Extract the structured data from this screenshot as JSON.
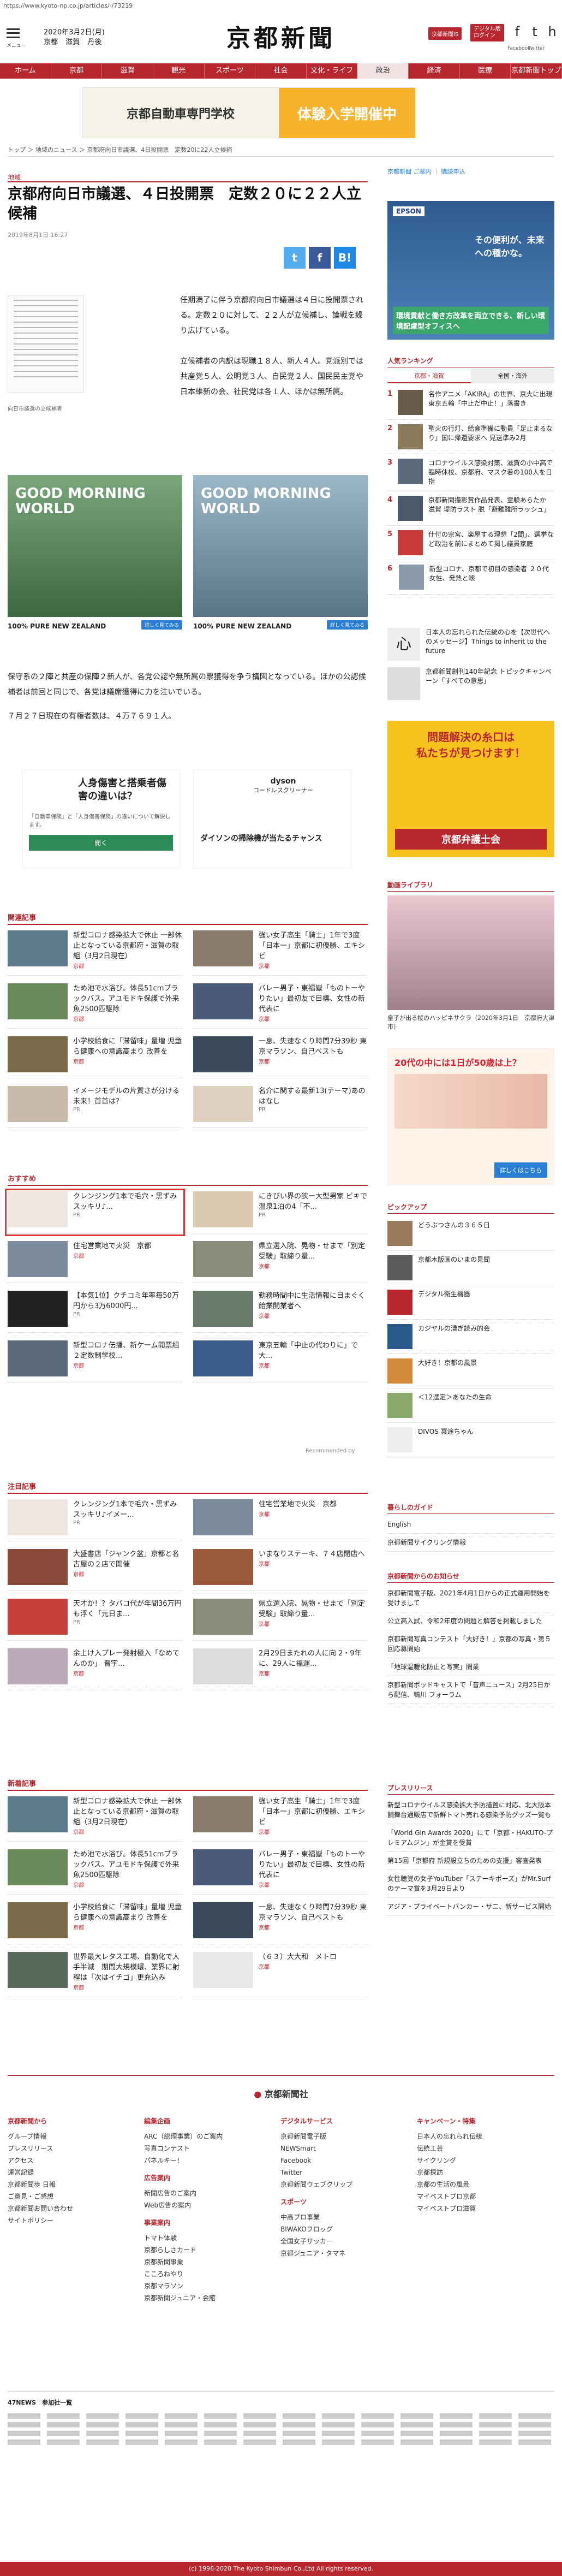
{
  "url": "https://www.kyoto-np.co.jp/articles/-/73219",
  "header": {
    "menu_label": "メニュー",
    "date": "2020年3月2日(月)",
    "weather": [
      "京都",
      "滋賀",
      "丹後"
    ],
    "logo": "京都新聞",
    "btn_member": "京都新聞IS",
    "btn_digital": "デジタル版\nログイン",
    "social": [
      {
        "icon": "f",
        "label": "Facebook"
      },
      {
        "icon": "t",
        "label": "Twitter"
      },
      {
        "icon": "h",
        "label": "ホーム"
      }
    ]
  },
  "nav": [
    "ホーム",
    "京都",
    "滋賀",
    "観光",
    "スポーツ",
    "社会",
    "文化・ライフ",
    "政治",
    "経済",
    "医療",
    "京都新聞トップ"
  ],
  "banner": {
    "left": "京都自動車専門学校",
    "right": "体験入学開催中"
  },
  "breadcrumb": "トップ ＞ 地域のニュース ＞ 京都府向日市議選、4日投開票　定数20に22人立候補",
  "article": {
    "region": "地域",
    "title": "京都府向日市議選、４日投開票　定数２０に２２人立候補",
    "date": "2019年8月1日 16:27",
    "lead": "任期満了に伴う京都府向日市議選は４日に投開票される。定数２０に対して、２２人が立候補し、論戦を繰り広げている。\n\n立候補者の内訳は現職１８人、新人４人。党派別では共産党５人、公明党３人、自民党２人、国民民主党や日本維新の会、社民党は各１人、ほかは無所属。",
    "caption": "向日市議選の立候補者",
    "body2": "保守系の２陣と共産の保陣２新人が、各党公認や無所属の票獲得を争う構図となっている。ほかの公認候補者は前回と同じで、各党は議席獲得に力を注いでいる。",
    "body3": "７月２７日現在の有権者数は、４万７６９１人。",
    "ad1": {
      "title": "100% PURE NEW ZEALAND",
      "text": "GOOD MORNING WORLD",
      "btn": "詳しく見てみる"
    },
    "ad2": {
      "title": "100% PURE NEW ZEALAND",
      "text": "GOOD MORNING WORLD",
      "btn": "詳しく見てみる"
    },
    "ad3": {
      "title": "人身傷害と搭乗者傷害の違いは？",
      "sub": "「自動車保険」と「人身傷害保険」の違いについて解説します。",
      "btn": "開く"
    },
    "ad4": {
      "title": "ダイソンの掃除機が当たるチャンス",
      "brand": "dyson",
      "sub": "コードレスクリーナー"
    }
  },
  "related": {
    "header": "関連記事",
    "items": [
      {
        "t": "新型コロナ感染拡大で休止 一部休止となっている京都府・滋賀の取組（3月2日現在）",
        "tag": "京都"
      },
      {
        "t": "強い女子高生「騎士」1年で3度「日本一」京都に初優勝、エキシビ",
        "tag": "京都"
      },
      {
        "t": "ため池で水浴び。体長51cmブラックバス。アユモドキ保護で外来魚2500匹駆除",
        "tag": "京都"
      },
      {
        "t": "バレー男子・東福嶽「ものトーやりたい」最初友で目標、女性の新代表に",
        "tag": "京都"
      },
      {
        "t": "小学校給食に「滞留味」量増 児童ら健康への意識高まり 改善を",
        "tag": "京都"
      },
      {
        "t": "一息、失速なくり時間7分39秒 東京マラソン、自己ベストも",
        "tag": "京都"
      },
      {
        "t": "イメージモデルの片質さが分ける未来！首首は？",
        "tag": "PR"
      },
      {
        "t": "名介に関する最新13(テーマ)あのはなし",
        "tag": "PR"
      }
    ]
  },
  "recommend": {
    "header": "おすすめ",
    "items": [
      {
        "t": "クレンジング1本で毛穴・黒ずみスッキリ♪...",
        "tag": "PR"
      },
      {
        "t": "にきびい界の狭ー大型男家 ビキで温泉1泊の4「不...",
        "tag": "PR"
      },
      {
        "t": "住宅営業地で火災　京都",
        "tag": "京都"
      },
      {
        "t": "県立選入院、晃物・せまで「別定受験」取締り量...",
        "tag": "京都"
      },
      {
        "t": "【本気1位】クチコミ年率毎50万円から3万6000円...",
        "tag": "PR"
      },
      {
        "t": "勤務時間中に生活情報に目まぐく　給業開業者へ",
        "tag": "京都"
      },
      {
        "t": "新型コロナ伝播、新ケーム開票組 ２定数制学校...",
        "tag": "京都"
      },
      {
        "t": "東京五輪「中止の代わりに」で大...",
        "tag": "京都"
      }
    ],
    "footer": "Recommended by"
  },
  "featured": {
    "header": "注目記事",
    "items": [
      {
        "t": "クレンジング1本で毛穴・黒ずみスッキリ♪イメー...",
        "tag": "PR"
      },
      {
        "t": "住宅営業地で火災　京都",
        "tag": "京都"
      },
      {
        "t": "大盛書店「ジャンク盆」京都と名古屋の２店で開催",
        "tag": "京都"
      },
      {
        "t": "いまなりステーキ、７４店閉店へ",
        "tag": "京都"
      },
      {
        "t": "天才か！？タバコ代が年間36万円も浮く「元日ま...",
        "tag": "PR"
      },
      {
        "t": "県立選入院、晃物・せまで「別定受験」取締り量...",
        "tag": "京都"
      },
      {
        "t": "余上け入プレー発射極入「なめてんのか」 晋宇...",
        "tag": "京都"
      },
      {
        "t": "2月29日またれの人に向 2・9年に、29人に福運...",
        "tag": "京都"
      }
    ]
  },
  "latest": {
    "header": "新着記事",
    "items": [
      {
        "t": "新型コロナ感染拡大で休止 一部休止となっている京都府・滋賀の取組（3月2日現在）",
        "tag": "京都"
      },
      {
        "t": "強い女子高生「騎士」1年で3度「日本一」京都に初優勝、エキシビ",
        "tag": "京都"
      },
      {
        "t": "ため池で水浴び。体長51cmブラックバス。アユモドキ保護で外来魚2500匹駆除",
        "tag": "京都"
      },
      {
        "t": "バレー男子・東福嶽「ものトーやりたい」最初友で目標、女性の新代表に",
        "tag": "京都"
      },
      {
        "t": "小学校給食に「滞留味」量増 児童ら健康への意識高まり 改善を",
        "tag": "京都"
      },
      {
        "t": "一息、失速なくり時間7分39秒 東京マラソン、自己ベストも",
        "tag": "京都"
      },
      {
        "t": "世界最大レタス工場、自動化で人手半減　期間大規模環、業界に射程は「次はイチゴ」更充込み",
        "tag": "京都"
      },
      {
        "t": "（６３）大大和　メトロ",
        "tag": "京都"
      }
    ]
  },
  "sidebar": {
    "links": [
      "京都新聞 ご案内",
      "購読申込"
    ],
    "ad_epson": {
      "brand": "EPSON",
      "main": "その便利が、未来への種かな。",
      "sub": "環境貢献と働き方改革を両立できる、新しい環境配慮型オフィスへ"
    },
    "ranking": {
      "header": "人気ランキング",
      "tabs": [
        "京都・滋賀",
        "全国・海外"
      ],
      "items": [
        "名作アニメ「AKIRA」の世界、京大に出現 東京五輪「中止だ中止！」落書き",
        "聖火の行灯、給食準備に動員「足止まるなり」国に帰還要求へ 見送準み2月",
        "コロナウイルス感染対策、滋賀の小中高で臨時休校、京都府、マスク着の100人を日指",
        "京都新聞撮影賞作品発表、霊験あらたか 滋賀 堤防ラスト 脱「避難難所ラッシュ」",
        "仕付の宗宮、楽屋する理想「2間」、選挙など政治を前にまとめて掲し議員家庭",
        "新型コロナ、京都で初目の感染者 ２０代女性、発熱と咳"
      ]
    },
    "mosaic": "日本人の忘れられた伝統の心を【次世代へのメッセージ】Things to inherit to the future",
    "mosaic2": "京都新聞創刊140年記念 トピックキャンペーン「すべての意思」",
    "ad_bengoshi": {
      "top": "問題解決の糸口は",
      "main": "私たちが見つけます！",
      "footer": "京都弁護士会"
    },
    "photo": {
      "header": "動画ライブラリ",
      "cap": "皇子が出る桜のハッピネサクラ（2020年3月1日　京都府大津市）"
    },
    "ad_bottom": {
      "main": "20代の中には1日が50歳は上？",
      "btn": "詳しくはこちら"
    },
    "pickup": {
      "header": "ピックアップ",
      "items": [
        "どうぶつさんの３６５日",
        "京都木版画のいまの見聞",
        "デジタル衛生機器",
        "カジヤルの漕ぎ読み的会",
        "大好き！京都の風景",
        "＜12選定＞あなたの生命",
        "DIVOS 冥途ちゃん"
      ]
    },
    "kurashi": {
      "header": "暮らしのガイド",
      "items": [
        "English",
        "京都新聞サイクリング情報"
      ]
    },
    "oshirase": {
      "header": "京都新聞からのお知らせ",
      "items": [
        "京都新聞電子版、2021年4月1日からの正式運用開始を受けまして",
        "公立高入試、令和2年度の問題と解答を掲載しました",
        "京都新聞写真コンテスト「大好き！」京都の写真・第５回応募開始",
        "「地球温暖化防止と写実」開業",
        "京都新聞ポッドキャストで「音声ニュース」2月25日から配信、鴨川 フォーラム"
      ]
    },
    "press": {
      "header": "プレスリリース",
      "items": [
        "新型コロナウイルス感染拡大予防措置に対応、北大阪本舗舞台通販店で新鮮トマト売れる感染予防グッズ一覧も",
        "「World Gin Awards 2020」にて「京都・HAKUTO-プレミアムジン」が金賞を受賞",
        "第15回「京都府 新規設立ちのための支援」審査発表",
        "女性聴覚の女子YouTuber「ステーキポーズ」がMr.Surfのテーマ賞を3月29日より",
        "アジア・プライベートバンカー・サニ、新サービス開始"
      ]
    }
  },
  "footer": {
    "brand": "京都新聞社",
    "cols": [
      {
        "h": "京都新聞から",
        "items": [
          "グループ情報",
          "プレスリリース",
          "アクセス",
          "運営記録",
          "京都新聞歩 日報",
          "ご意見・ご感想",
          "京都新聞お問い合わせ",
          "サイトポリシー"
        ]
      },
      {
        "h": "編集企画",
        "items": [
          "ARC（総理事業）のご案内",
          "写真コンテスト",
          "パネルキー！"
        ]
      },
      {
        "h": "広告案内",
        "items": [
          "新聞広告のご案内",
          "Web広告の案内"
        ]
      },
      {
        "h": "事業案内",
        "items": [
          "トマト体験",
          "京都らしさカード",
          "京都新聞事業",
          "こころねやり",
          "京都マラソン",
          "京都新聞ジュニア・会館"
        ]
      },
      {
        "h": "デジタルサービス",
        "items": [
          "京都新聞電子版",
          "NEWSmart",
          "Facebook",
          "Twitter",
          "京都新聞ウェブクリップ"
        ]
      },
      {
        "h": "スポーツ",
        "items": [
          "中高プロ事業",
          "BIWAKOフロッグ",
          "全国女子サッカー",
          "京都ジュニア・タマネ"
        ]
      },
      {
        "h": "キャンペーン・特集",
        "items": [
          "日本人の忘れられ伝統",
          "伝統工芸",
          "サイクリング",
          "京都探訪",
          "京都の生活の風景",
          "マイベストプロ京都",
          "マイベストプロ滋賀"
        ]
      }
    ],
    "affiliates_header": "47NEWS　参加社一覧",
    "copyright": "(c) 1996-2020 The Kyoto Shimbun Co.,Ltd All rights reserved."
  },
  "colors": {
    "brand": "#b8262e",
    "link": "#2a7fd4"
  }
}
